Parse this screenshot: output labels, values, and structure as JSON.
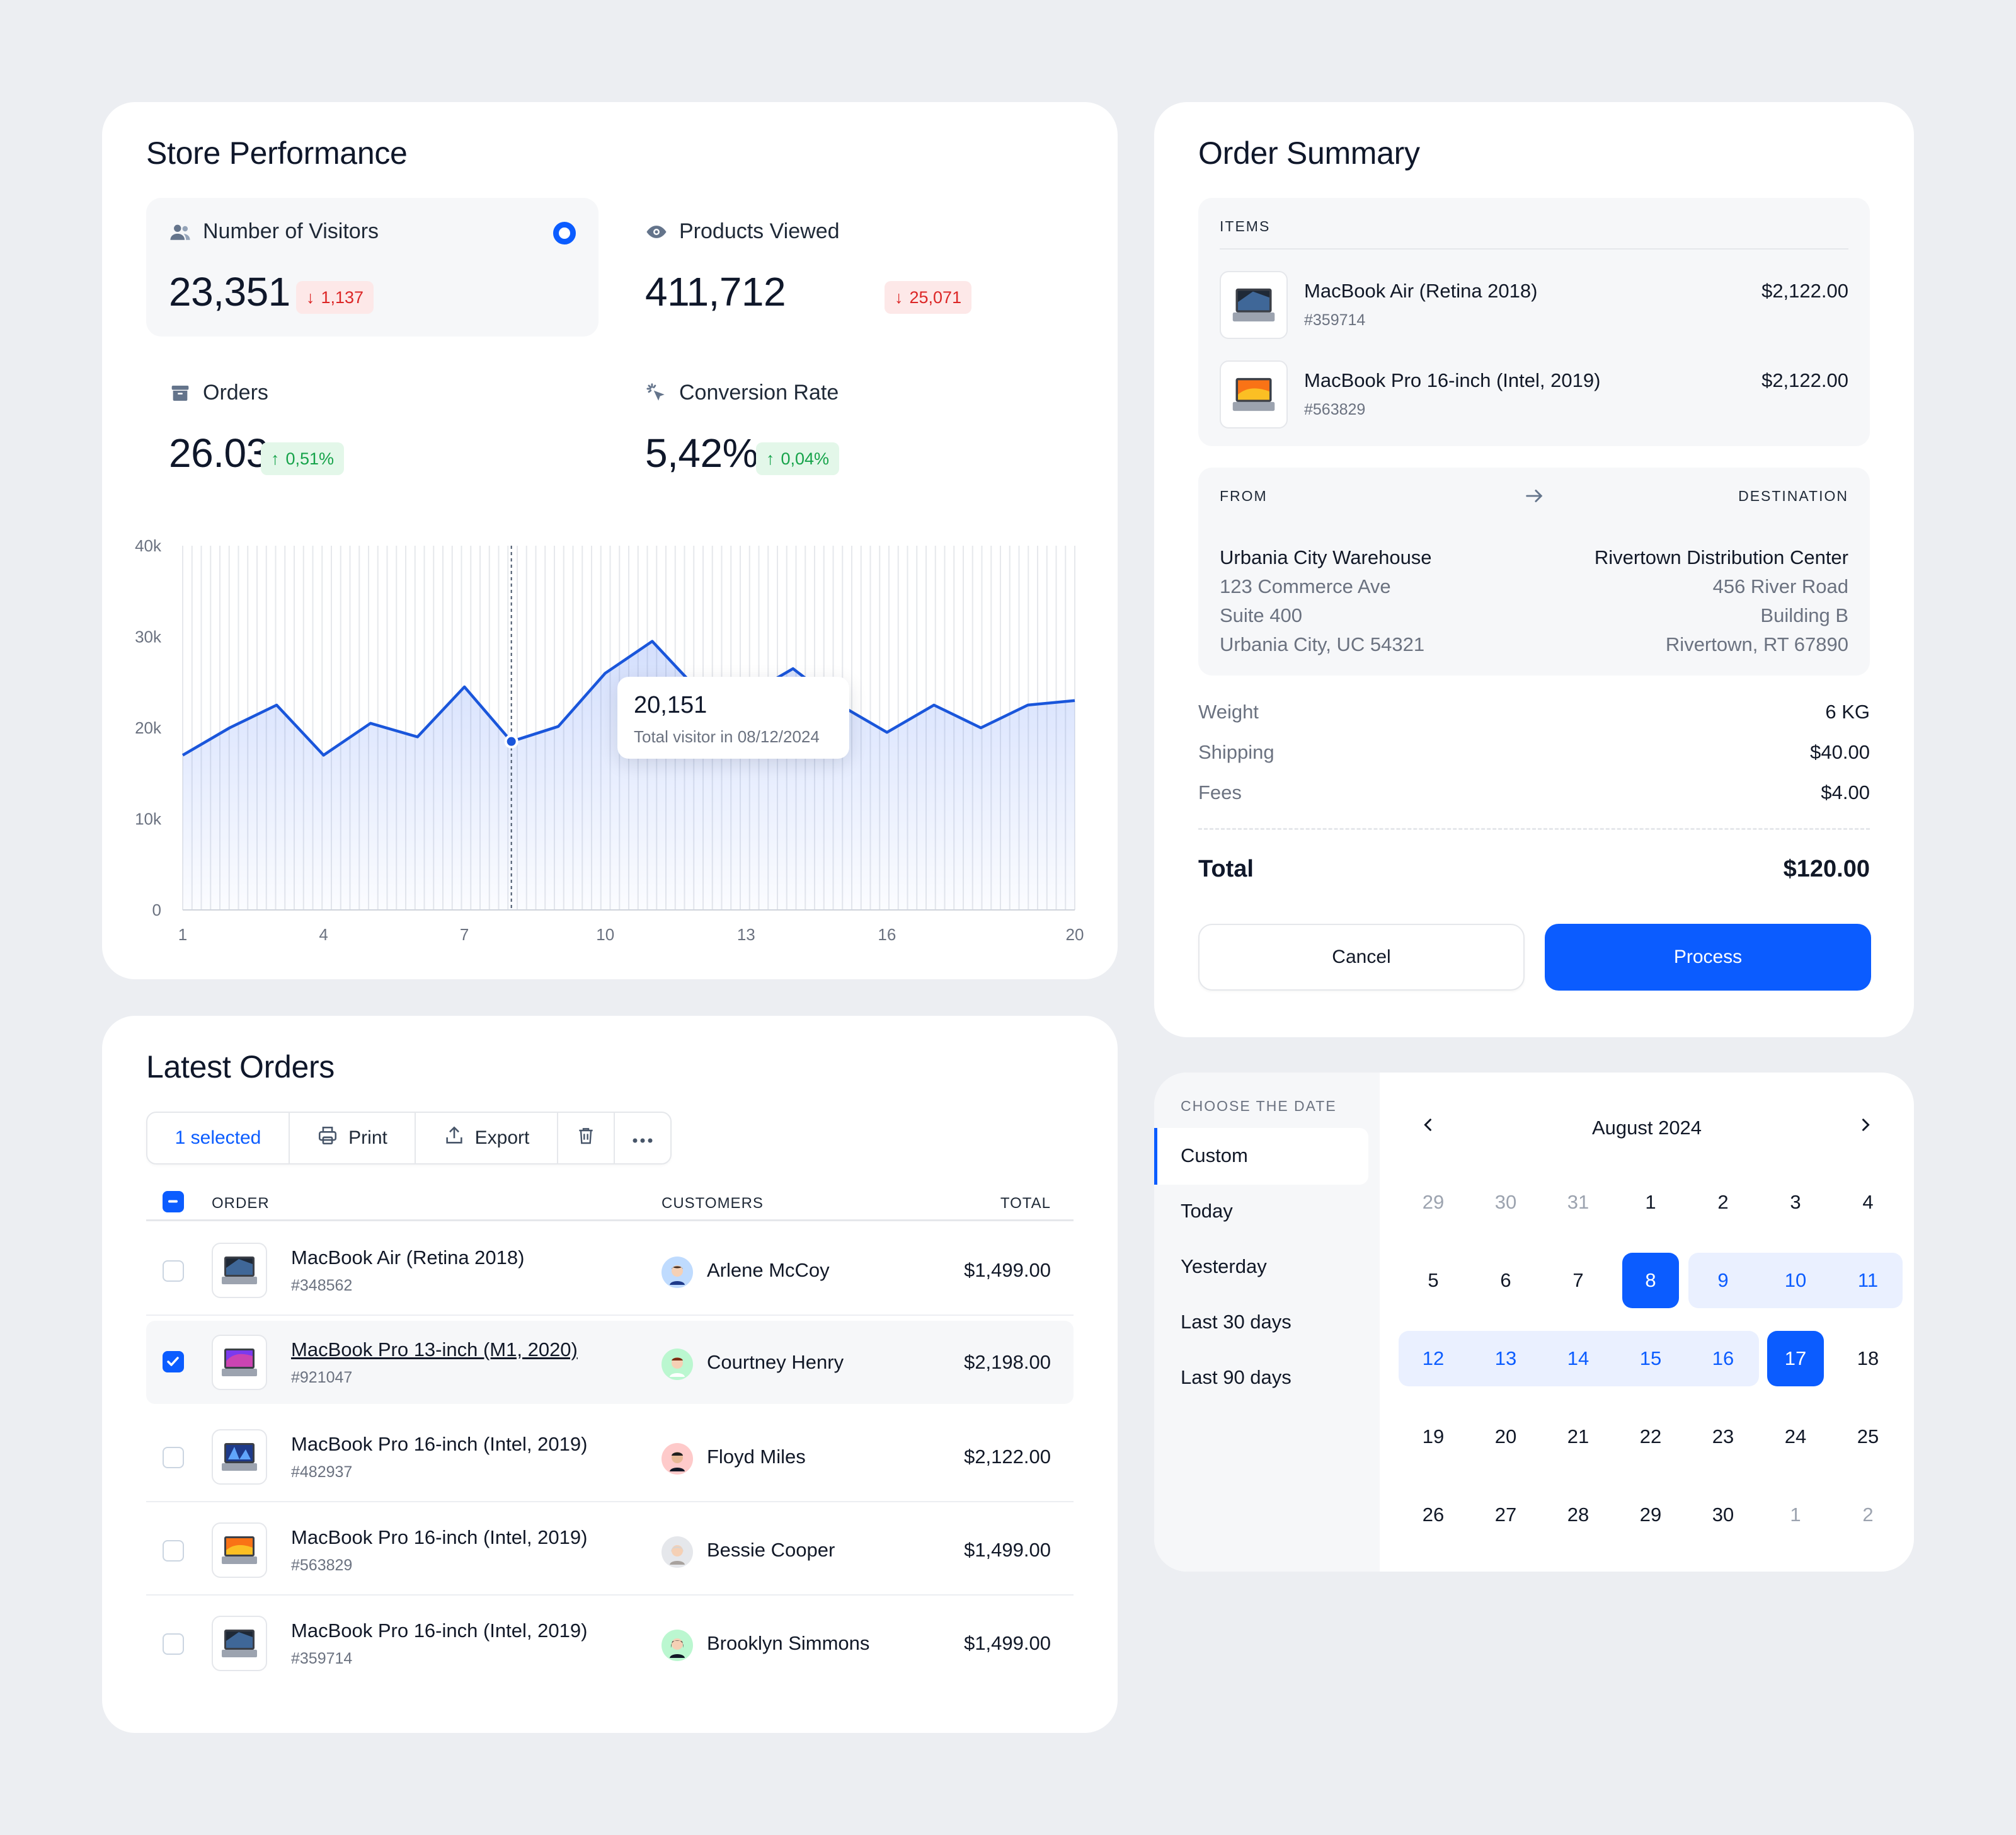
{
  "performance": {
    "title": "Store Performance",
    "metrics": [
      {
        "label": "Number of Visitors",
        "value": "23,351",
        "delta": "1,137",
        "trend": "down",
        "icon": "users-icon"
      },
      {
        "label": "Products Viewed",
        "value": "411,712",
        "delta": "25,071",
        "trend": "down",
        "icon": "eye-icon"
      },
      {
        "label": "Orders",
        "value": "26.03",
        "delta": "0,51%",
        "trend": "up",
        "icon": "box-icon"
      },
      {
        "label": "Conversion Rate",
        "value": "5,42%",
        "delta": "0,04%",
        "trend": "up",
        "icon": "cursor-click-icon"
      }
    ],
    "tooltip": {
      "value": "20,151",
      "label": "Total visitor in 08/12/2024"
    }
  },
  "chart_data": {
    "type": "area",
    "x": [
      1,
      2,
      3,
      4,
      5,
      6,
      7,
      8,
      9,
      10,
      11,
      12,
      13,
      14,
      15,
      16,
      17,
      18,
      19,
      20
    ],
    "series": [
      {
        "values": [
          17000,
          20000,
          22500,
          17000,
          20500,
          19000,
          24500,
          18500,
          20151,
          26000,
          29500,
          24000,
          23500,
          26500,
          22500,
          19500,
          22500,
          20000,
          22500,
          23000
        ]
      }
    ],
    "xticks": [
      "1",
      "4",
      "7",
      "10",
      "13",
      "16",
      "20"
    ],
    "yticks": [
      "0",
      "10k",
      "20k",
      "30k",
      "40k"
    ],
    "ylim": [
      0,
      40000
    ],
    "xlim": [
      1,
      20
    ],
    "highlight_x": 8,
    "color": "#1a56db",
    "grid": true
  },
  "orders": {
    "title": "Latest Orders",
    "toolbar": {
      "selected": "1 selected",
      "print": "Print",
      "export": "Export"
    },
    "columns": {
      "order": "ORDER",
      "customers": "CUSTOMERS",
      "total": "TOTAL"
    },
    "rows": [
      {
        "name": "MacBook Air (Retina 2018)",
        "id": "#348562",
        "customer": "Arlene McCoy",
        "total": "$1,499.00",
        "checked": false
      },
      {
        "name": "MacBook Pro 13-inch (M1, 2020)",
        "id": "#921047",
        "customer": "Courtney Henry",
        "total": "$2,198.00",
        "checked": true
      },
      {
        "name": "MacBook Pro 16-inch (Intel, 2019)",
        "id": "#482937",
        "customer": "Floyd Miles",
        "total": "$2,122.00",
        "checked": false
      },
      {
        "name": "MacBook Pro 16-inch (Intel, 2019)",
        "id": "#563829",
        "customer": "Bessie Cooper",
        "total": "$1,499.00",
        "checked": false
      },
      {
        "name": "MacBook Pro 16-inch (Intel, 2019)",
        "id": "#359714",
        "customer": "Brooklyn Simmons",
        "total": "$1,499.00",
        "checked": false
      }
    ]
  },
  "summary": {
    "title": "Order Summary",
    "items_label": "ITEMS",
    "items": [
      {
        "name": "MacBook Air (Retina 2018)",
        "id": "#359714",
        "price": "$2,122.00"
      },
      {
        "name": "MacBook Pro 16-inch (Intel, 2019)",
        "id": "#563829",
        "price": "$2,122.00"
      }
    ],
    "from_label": "FROM",
    "destination_label": "DESTINATION",
    "from": [
      "Urbania City Warehouse",
      "123 Commerce Ave",
      "Suite 400",
      "Urbania City, UC 54321"
    ],
    "destination": [
      "Rivertown Distribution Center",
      "456 River Road",
      "Building B",
      "Rivertown, RT 67890"
    ],
    "weight_label": "Weight",
    "weight": "6 KG",
    "shipping_label": "Shipping",
    "shipping": "$40.00",
    "fees_label": "Fees",
    "fees": "$4.00",
    "total_label": "Total",
    "total": "$120.00",
    "cancel": "Cancel",
    "process": "Process"
  },
  "calendar": {
    "choose_label": "CHOOSE THE DATE",
    "options": [
      "Custom",
      "Today",
      "Yesterday",
      "Last 30 days",
      "Last 90 days"
    ],
    "active_option": "Custom",
    "month": "August 2024",
    "weeks": [
      [
        "29",
        "30",
        "31",
        "1",
        "2",
        "3",
        "4"
      ],
      [
        "5",
        "6",
        "7",
        "8",
        "9",
        "10",
        "11"
      ],
      [
        "12",
        "13",
        "14",
        "15",
        "16",
        "17",
        "18"
      ],
      [
        "19",
        "20",
        "21",
        "22",
        "23",
        "24",
        "25"
      ],
      [
        "26",
        "27",
        "28",
        "29",
        "30",
        "1",
        "2"
      ]
    ],
    "range_start": "8",
    "range_end": "17"
  },
  "colors": {
    "accent": "#0b5cff",
    "down": "#dc2626",
    "up": "#16a34a",
    "background": "#eceef2"
  }
}
